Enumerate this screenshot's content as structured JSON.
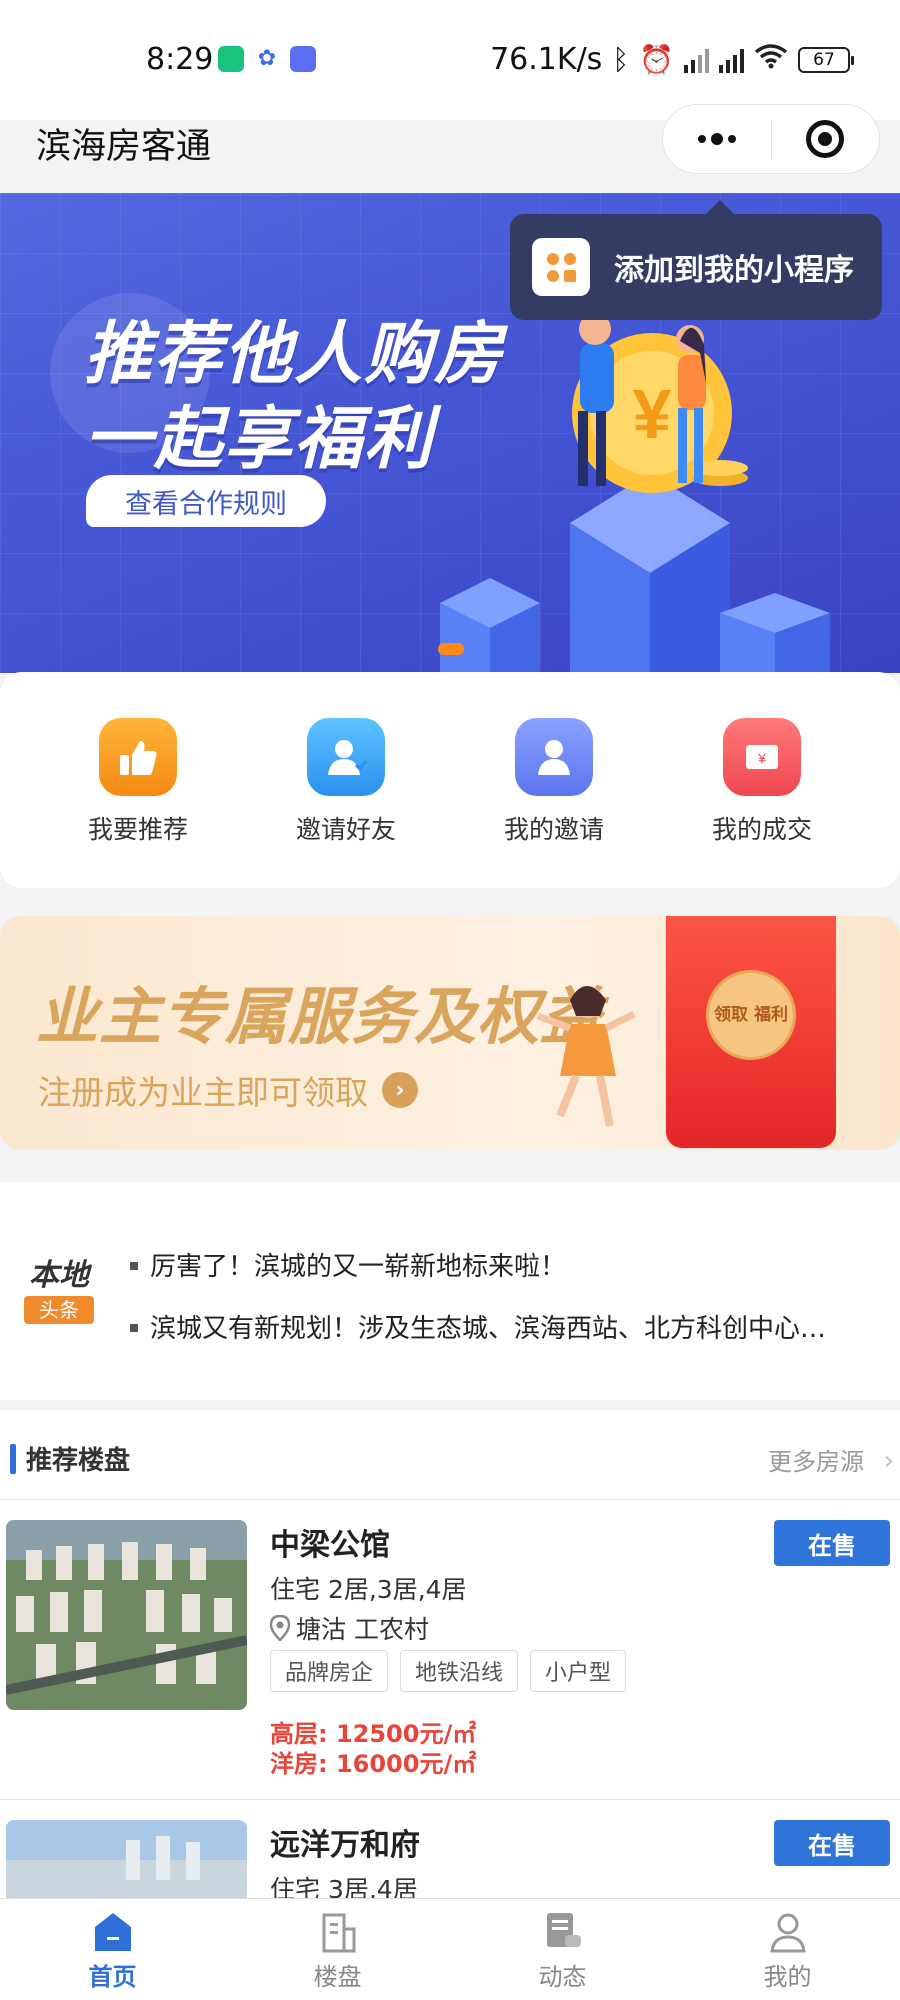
{
  "status_bar": {
    "time": "8:29",
    "net_speed": "76.1K/s",
    "battery": "67"
  },
  "header": {
    "title": "滨海房客通"
  },
  "banner": {
    "line1": "推荐他人购房",
    "line2": "一起享福利",
    "button": "查看合作规则"
  },
  "mini_program_tip": {
    "text": "添加到我的小程序"
  },
  "quick_actions": [
    {
      "label": "我要推荐",
      "icon": "thumbs-up-icon",
      "color": "#f49a1a"
    },
    {
      "label": "邀请好友",
      "icon": "invite-friend-icon",
      "color": "#39a0f0"
    },
    {
      "label": "我的邀请",
      "icon": "my-invitations-icon",
      "color": "#6b86f4"
    },
    {
      "label": "我的成交",
      "icon": "deal-ticket-icon",
      "color": "#f2595a"
    }
  ],
  "owner_banner": {
    "title": "业主专属服务及权益",
    "subtitle": "注册成为业主即可领取",
    "packet_text": "领取 福利"
  },
  "news": {
    "badge_top": "本地",
    "badge_bottom": "头条",
    "items": [
      "厉害了！滨城的又一崭新地标来啦！",
      "滨城又有新规划！涉及生态城、滨海西站、北方科创中心…"
    ]
  },
  "recommended": {
    "title": "推荐楼盘",
    "more": "更多房源",
    "properties": [
      {
        "name": "中梁公馆",
        "status": "在售",
        "type": "住宅 2居,3居,4居",
        "location": "塘沽 工农村",
        "tags": [
          "品牌房企",
          "地铁沿线",
          "小户型"
        ],
        "prices": [
          "高层: 12500元/㎡",
          "洋房: 16000元/㎡"
        ]
      },
      {
        "name": "远洋万和府",
        "status": "在售",
        "type": "住宅 3居,4居"
      }
    ]
  },
  "tab_bar": [
    {
      "label": "首页",
      "active": true
    },
    {
      "label": "楼盘",
      "active": false
    },
    {
      "label": "动态",
      "active": false
    },
    {
      "label": "我的",
      "active": false
    }
  ]
}
